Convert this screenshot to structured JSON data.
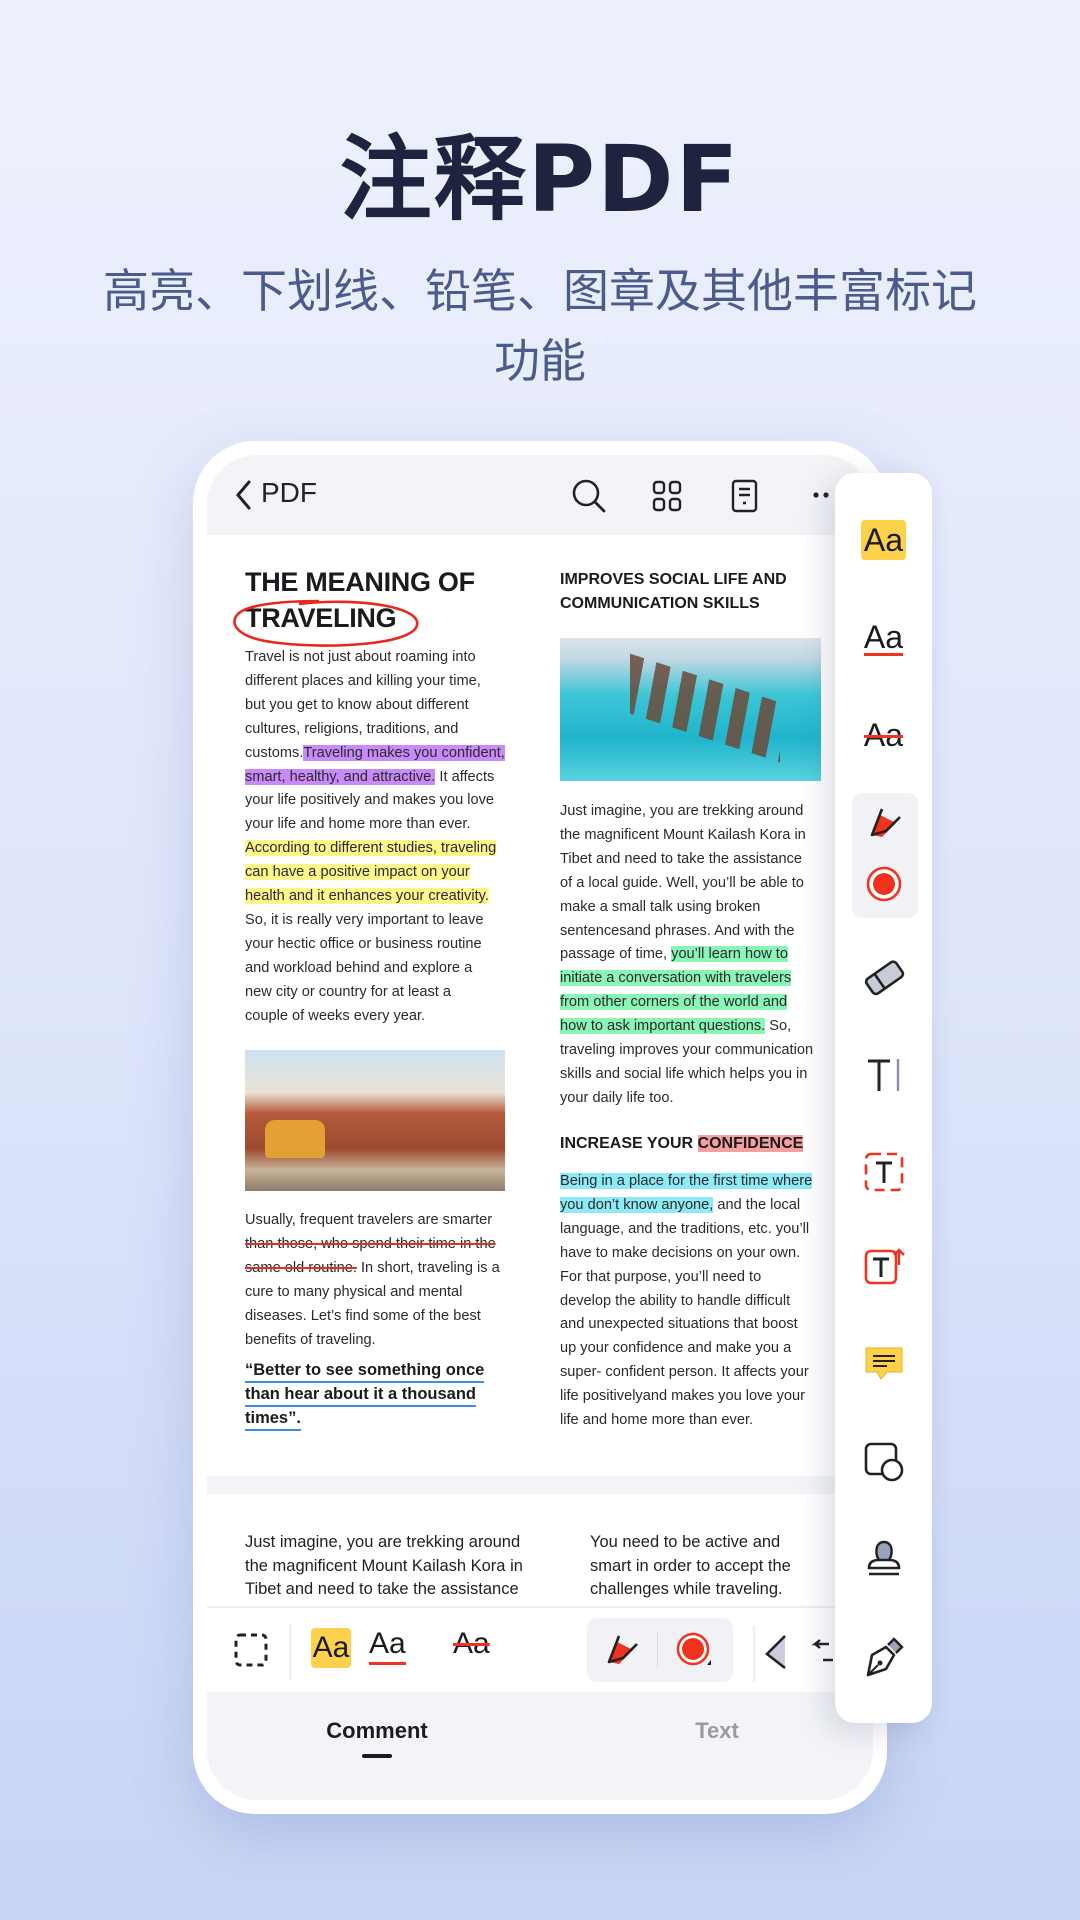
{
  "hero": {
    "title": "注释PDF",
    "subtitle_line1": "高亮、下划线、铅笔、图章及其他丰富标记",
    "subtitle_line2": "功能"
  },
  "topbar": {
    "back_icon": "chevron-left-icon",
    "title": "PDF",
    "icons": [
      "search-icon",
      "grid-icon",
      "document-icon",
      "more-icon"
    ]
  },
  "doc": {
    "left_title_1": "THE MEANING OF",
    "left_title_2": "TRAVELING",
    "left_p1": [
      [
        {
          "t": "Travel is not just about roaming into"
        }
      ],
      [
        {
          "t": "different places and killing your time,"
        }
      ],
      [
        {
          "t": "but you get to know about different"
        }
      ],
      [
        {
          "t": "cultures, religions, traditions, and"
        }
      ],
      [
        {
          "t": "customs."
        },
        {
          "t": "Traveling makes you confident,",
          "m": "purple"
        }
      ],
      [
        {
          "t": "smart, healthy, and attractive.",
          "m": "purple"
        },
        {
          "t": " It affects"
        }
      ],
      [
        {
          "t": "your life positively and makes you love"
        }
      ],
      [
        {
          "t": "your life and home more than ever."
        }
      ],
      [
        {
          "t": "According to different studies, traveling",
          "m": "yellow"
        }
      ],
      [
        {
          "t": "can have a positive impact on your",
          "m": "yellow"
        }
      ],
      [
        {
          "t": "health and it enhances your creativity.",
          "m": "yellow"
        }
      ],
      [
        {
          "t": "So, it is really very important to leave"
        }
      ],
      [
        {
          "t": "your hectic office or business routine"
        }
      ],
      [
        {
          "t": "and workload behind and explore a"
        }
      ],
      [
        {
          "t": "new city or country for at least a"
        }
      ],
      [
        {
          "t": "couple of weeks every year."
        }
      ]
    ],
    "left_p2": [
      [
        {
          "t": "Usually, frequent travelers are smarter"
        }
      ],
      [
        {
          "t": "than those, who spend their time in the",
          "m": "strike"
        }
      ],
      [
        {
          "t": "same old routine.",
          "m": "strike"
        },
        {
          "t": " In short, traveling is a"
        }
      ],
      [
        {
          "t": "cure to many physical and mental"
        }
      ],
      [
        {
          "t": "diseases. Let’s find some of the best"
        }
      ],
      [
        {
          "t": "benefits of traveling."
        }
      ]
    ],
    "quote": [
      "“Better to see something once",
      "than hear about it a thousand",
      "times”."
    ],
    "right_title_1": "IMPROVES SOCIAL LIFE AND",
    "right_title_2": "COMMUNICATION SKILLS",
    "right_p1": [
      [
        {
          "t": "Just imagine, you are trekking around"
        }
      ],
      [
        {
          "t": "the magnificent Mount Kailash Kora in"
        }
      ],
      [
        {
          "t": "Tibet and need to take the assistance"
        }
      ],
      [
        {
          "t": "of a local guide. Well, you’ll be able to"
        }
      ],
      [
        {
          "t": "make a small talk using broken"
        }
      ],
      [
        {
          "t": "sentencesand phrases. And with the"
        }
      ],
      [
        {
          "t": "passage of time, "
        },
        {
          "t": "you’ll learn how to",
          "m": "green"
        }
      ],
      [
        {
          "t": "initiate a conversation with travelers",
          "m": "green"
        }
      ],
      [
        {
          "t": "from other corners of the world and",
          "m": "green"
        }
      ],
      [
        {
          "t": "how to ask important questions.",
          "m": "green"
        },
        {
          "t": " So,"
        }
      ],
      [
        {
          "t": "traveling improves your communication"
        }
      ],
      [
        {
          "t": "skills and social life which helps you in"
        }
      ],
      [
        {
          "t": "your daily life too."
        }
      ]
    ],
    "right_heading": [
      {
        "t": "INCREASE YOUR "
      },
      {
        "t": "CONFIDENCE",
        "m": "pink"
      }
    ],
    "right_p2": [
      [
        {
          "t": "Being in a place for the first time where",
          "m": "cyan"
        }
      ],
      [
        {
          "t": "you don’t know anyone,",
          "m": "cyan"
        },
        {
          "t": " and the local"
        }
      ],
      [
        {
          "t": "language, and the traditions, etc. you’ll"
        }
      ],
      [
        {
          "t": "have to make decisions on your own."
        }
      ],
      [
        {
          "t": "For that purpose, you’ll need to"
        }
      ],
      [
        {
          "t": "develop the ability to handle difficult"
        }
      ],
      [
        {
          "t": "and unexpected situations that boost"
        }
      ],
      [
        {
          "t": "up your confidence and make you a"
        }
      ],
      [
        {
          "t": "super- confident person. It affects your"
        }
      ],
      [
        {
          "t": "life positivelyand makes you love your"
        }
      ],
      [
        {
          "t": "life and home more than ever."
        }
      ]
    ],
    "next_left": [
      "Just imagine, you are trekking around",
      "the magnificent Mount Kailash Kora in",
      "Tibet and need to take the assistance"
    ],
    "next_right": [
      "You need to be active and",
      "smart in order to accept the",
      "challenges while traveling."
    ]
  },
  "toolbar": {
    "icons": [
      "select-area-icon",
      "highlight-icon",
      "underline-icon",
      "strikethrough-icon",
      "highlighter-pen-icon",
      "color-red-icon",
      "eraser-icon",
      "undo-icon"
    ],
    "aa": "Aa"
  },
  "tabs": [
    {
      "label": "Comment",
      "active": true
    },
    {
      "label": "Text",
      "active": false
    }
  ],
  "panel": {
    "aa": "Aa",
    "items": [
      "highlight",
      "underline",
      "strikethrough",
      "highlighter-pen",
      "color",
      "eraser",
      "text",
      "text-box",
      "callout",
      "note",
      "shape",
      "stamp",
      "signature-pen"
    ]
  },
  "colors": {
    "accent_red": "#f0321e",
    "highlight_yellow": "#fdd14a",
    "title": "#1e2340",
    "subtitle": "#4b5b8c"
  }
}
